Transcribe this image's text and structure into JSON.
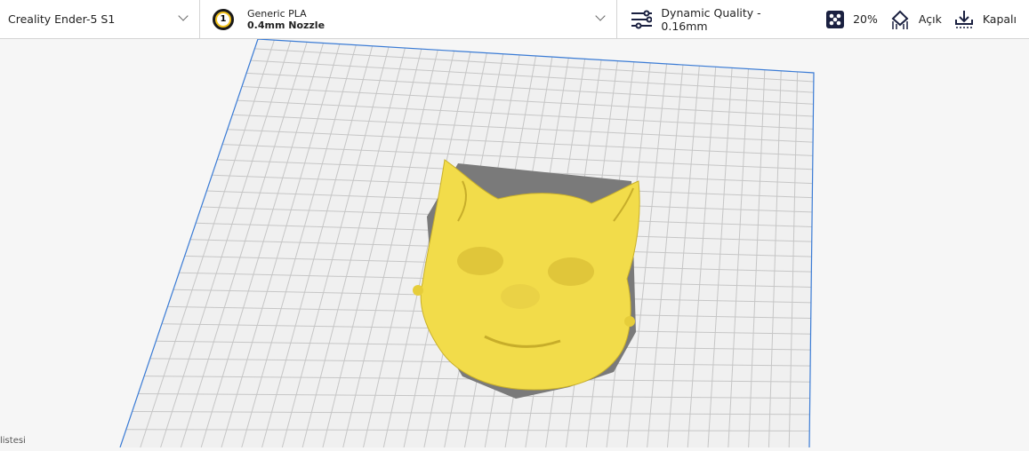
{
  "printer": {
    "name": "Creality Ender-5 S1"
  },
  "material": {
    "extruder_number": "1",
    "name": "Generic PLA",
    "nozzle": "0.4mm Nozzle"
  },
  "print_settings": {
    "profile": "Dynamic Quality - 0.16mm",
    "infill": "20%",
    "support": "Açık",
    "adhesion": "Kapalı"
  },
  "object_list": {
    "label": "listesi"
  },
  "colors": {
    "model": "#f2dc4a",
    "plate_edge": "#3a7bd5",
    "grid": "#c8c8c8"
  }
}
